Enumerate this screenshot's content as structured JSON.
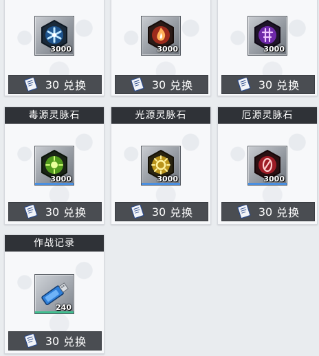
{
  "cards": [
    {
      "title": "",
      "count": "3000",
      "cost": "30",
      "action": "兑换",
      "icon": "blue-snowflake-crystal-icon",
      "accent": "#3aa9ff"
    },
    {
      "title": "",
      "count": "3000",
      "cost": "30",
      "action": "兑换",
      "icon": "red-flame-crystal-icon",
      "accent": "#ff5a3a"
    },
    {
      "title": "",
      "count": "3000",
      "cost": "30",
      "action": "兑换",
      "icon": "purple-rune-crystal-icon",
      "accent": "#b44cff"
    },
    {
      "title": "毒源灵脉石",
      "count": "3000",
      "cost": "30",
      "action": "兑换",
      "icon": "green-toxin-crystal-icon",
      "accent": "#8fe22a"
    },
    {
      "title": "光源灵脉石",
      "count": "3000",
      "cost": "30",
      "action": "兑换",
      "icon": "yellow-sun-crystal-icon",
      "accent": "#ffd12a"
    },
    {
      "title": "厄源灵脉石",
      "count": "3000",
      "cost": "30",
      "action": "兑换",
      "icon": "crimson-eye-crystal-icon",
      "accent": "#e0303a"
    },
    {
      "title": "作战记录",
      "count": "240",
      "cost": "30",
      "action": "兑换",
      "icon": "usb-battle-record-icon",
      "accent": "#3aa0ff"
    }
  ]
}
